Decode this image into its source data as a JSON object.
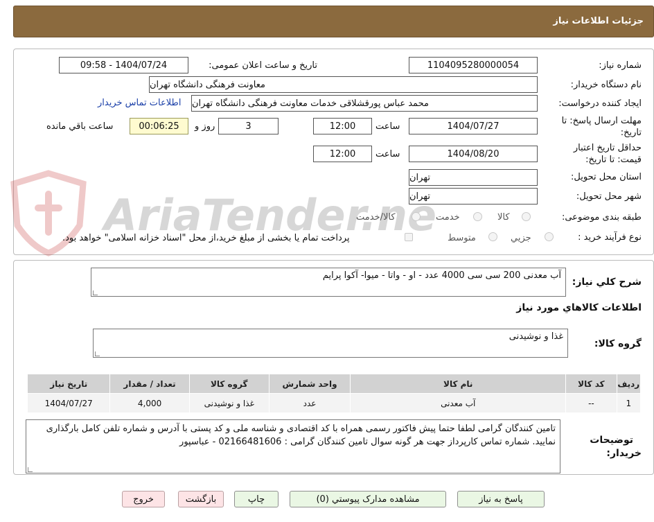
{
  "header": {
    "title": "جزئیات اطلاعات نیاز"
  },
  "info": {
    "need_number_label": "شماره نیاز:",
    "need_number": "1104095280000054",
    "announce_label": "تاریخ و ساعت اعلان عمومی:",
    "announce_value": "1404/07/24 - 09:58",
    "buyer_org_label": "نام دستگاه خریدار:",
    "buyer_org": "معاونت فرهنگی دانشگاه تهران",
    "requester_label": "ایجاد کننده درخواست:",
    "requester": "محمد عباس پورقشلاقی خدمات معاونت فرهنگی دانشگاه تهران",
    "contact_link": "اطلاعات تماس خریدار",
    "deadline_label_1": "مهلت ارسال پاسخ: تا",
    "deadline_label_2": "تاریخ:",
    "deadline_date": "1404/07/27",
    "time_label": "ساعت",
    "deadline_time": "12:00",
    "days_value": "3",
    "days_label": "روز و",
    "remaining_time": "00:06:25",
    "remaining_label": "ساعت باقي مانده",
    "validity_label_1": "حداقل تاریخ اعتبار",
    "validity_label_2": "قیمت: تا تاریخ:",
    "validity_date": "1404/08/20",
    "validity_time": "12:00",
    "province_label": "استان محل تحویل:",
    "province": "تهران",
    "city_label": "شهر محل تحویل:",
    "city": "تهران",
    "category_label": "طبقه بندی موضوعی:",
    "category_options": [
      "کالا",
      "خدمت",
      "کالا/خدمت"
    ],
    "process_label": "نوع فرآیند خرید :",
    "process_options": [
      "جزیي",
      "متوسط"
    ],
    "payment_note": "پرداخت تمام یا بخشی از مبلغ خرید،از محل \"اسناد خزانه اسلامی\" خواهد بود."
  },
  "watermark": {
    "text": "AriaTender.neT"
  },
  "description": {
    "label": "شرح کلي نیاز:",
    "value": "آب معدنی 200 سی سی 4000 عدد - او - واتا - میوا- آکوا پرایم"
  },
  "goods_section": {
    "title": "اطلاعات کالاهاي مورد نیاز",
    "group_label": "گروه کالا:",
    "group_value": "غذا و نوشیدنی"
  },
  "table": {
    "headers": [
      "ردیف",
      "کد کالا",
      "نام کالا",
      "واحد شمارش",
      "گروه کالا",
      "تعداد / مقدار",
      "تاریخ نیاز"
    ],
    "rows": [
      [
        "1",
        "--",
        "آب معدنی",
        "عدد",
        "غذا و نوشیدنی",
        "4,000",
        "1404/07/27"
      ]
    ]
  },
  "buyer_notes": {
    "label_1": "توضیحات",
    "label_2": "خریدار:",
    "value": "تامین کنندگان گرامی لطفا حتما پیش فاکتور رسمی همراه با کد اقتصادی و شناسه ملی و کد پستی با آدرس و شماره تلفن کامل بارگذاری نمایید. شماره تماس کارپرداز جهت هر گونه سوال تامین کنندگان گرامی : 02166481606 - عباسپور"
  },
  "buttons": {
    "reply": "پاسخ به نیاز",
    "attachments": "مشاهده مدارک پیوستي (0)",
    "print": "چاپ",
    "back": "بازگشت",
    "exit": "خروج"
  }
}
